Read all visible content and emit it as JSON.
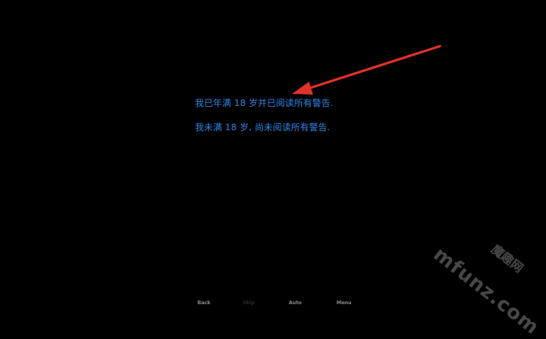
{
  "choices": [
    {
      "label": "我已年满 18 岁并已阅读所有警告."
    },
    {
      "label": "我未满 18 岁, 尚未阅读所有警告."
    }
  ],
  "quick_menu": {
    "back_label": "Back",
    "skip_label": "Skip",
    "auto_label": "Auto",
    "menu_label": "Menu"
  },
  "annotation": {
    "arrow_color": "#e0322a",
    "icon": "red-arrow-annotation"
  },
  "watermark": {
    "cn": "魔趣网",
    "en": "mfunz.com"
  },
  "colors": {
    "background": "#000000",
    "choice_text": "#2f86e6",
    "quick_menu_text": "#8a8a8a",
    "quick_menu_disabled": "#2b2b2b"
  }
}
